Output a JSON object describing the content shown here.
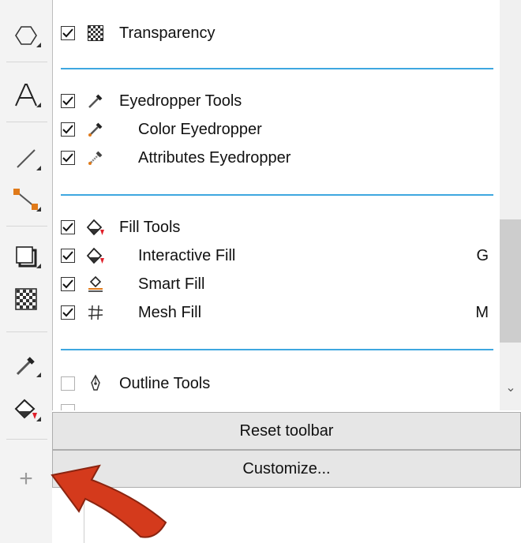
{
  "toolbar_items": [
    {
      "label": "Transparency",
      "checked": true,
      "level": 0,
      "shortcut": "",
      "icon": "transparency-icon"
    },
    {
      "label": "Eyedropper Tools",
      "checked": true,
      "level": 0,
      "shortcut": "",
      "icon": "eyedropper-icon"
    },
    {
      "label": "Color Eyedropper",
      "checked": true,
      "level": 1,
      "shortcut": "",
      "icon": "color-eyedropper-icon"
    },
    {
      "label": "Attributes Eyedropper",
      "checked": true,
      "level": 1,
      "shortcut": "",
      "icon": "attributes-eyedropper-icon"
    },
    {
      "label": "Fill Tools",
      "checked": true,
      "level": 0,
      "shortcut": "",
      "icon": "fill-icon"
    },
    {
      "label": "Interactive Fill",
      "checked": true,
      "level": 1,
      "shortcut": "G",
      "icon": "interactive-fill-icon"
    },
    {
      "label": "Smart Fill",
      "checked": true,
      "level": 1,
      "shortcut": "",
      "icon": "smart-fill-icon"
    },
    {
      "label": "Mesh Fill",
      "checked": true,
      "level": 1,
      "shortcut": "M",
      "icon": "mesh-fill-icon"
    },
    {
      "label": "Outline Tools",
      "checked": false,
      "level": 0,
      "shortcut": "",
      "icon": "outline-pen-icon"
    }
  ],
  "buttons": {
    "reset": "Reset toolbar",
    "customize": "Customize..."
  },
  "toolbox": {
    "tools": [
      "polygon-icon",
      "text-icon",
      "line-icon",
      "connector-icon",
      "drop-shadow-icon",
      "transparency-icon",
      "eyedropper-icon",
      "interactive-fill-icon"
    ],
    "add_tool": "+"
  },
  "colors": {
    "divider": "#3ea7e0",
    "annotation_arrow": "#d43a1c"
  }
}
